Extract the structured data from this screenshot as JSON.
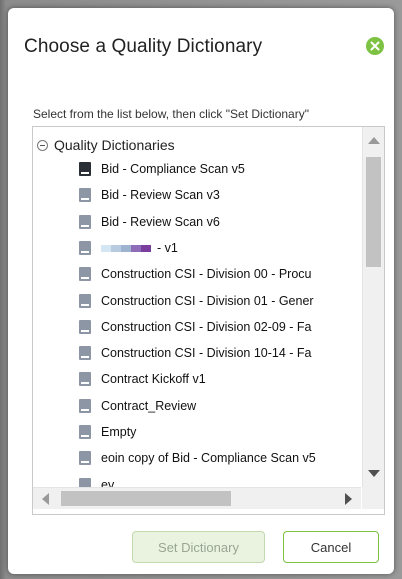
{
  "dialog": {
    "title": "Choose a Quality Dictionary",
    "close_icon": "green-circle-check-icon",
    "instructions": "Select from the list below, then click \"Set Dictionary\""
  },
  "tree": {
    "root_label": "Quality Dictionaries",
    "items": [
      {
        "label": "Bid - Compliance Scan v5",
        "icon": "dark"
      },
      {
        "label": "Bid - Review Scan v3",
        "icon": "light"
      },
      {
        "label": "Bid - Review Scan v6",
        "icon": "light"
      },
      {
        "label": "- v1",
        "icon": "light",
        "swatch": [
          "#d5e6f3",
          "#b8cbe0",
          "#9db3cf",
          "#8e6cb7",
          "#7a3f9e"
        ]
      },
      {
        "label": "Construction CSI - Division 00 - Procu",
        "icon": "light"
      },
      {
        "label": "Construction CSI - Division 01 - Gener",
        "icon": "light"
      },
      {
        "label": "Construction CSI - Division 02-09 - Fa",
        "icon": "light"
      },
      {
        "label": "Construction CSI - Division 10-14 - Fa",
        "icon": "light"
      },
      {
        "label": "Contract Kickoff v1",
        "icon": "light"
      },
      {
        "label": "Contract_Review",
        "icon": "light"
      },
      {
        "label": "Empty",
        "icon": "light"
      },
      {
        "label": "eoin copy of Bid - Compliance Scan v5",
        "icon": "light"
      },
      {
        "label": "ev",
        "icon": "light"
      }
    ]
  },
  "buttons": {
    "set_dictionary": "Set Dictionary",
    "cancel": "Cancel"
  },
  "colors": {
    "accent": "#7dc242",
    "disabled_button_bg": "#e9f3e0"
  }
}
